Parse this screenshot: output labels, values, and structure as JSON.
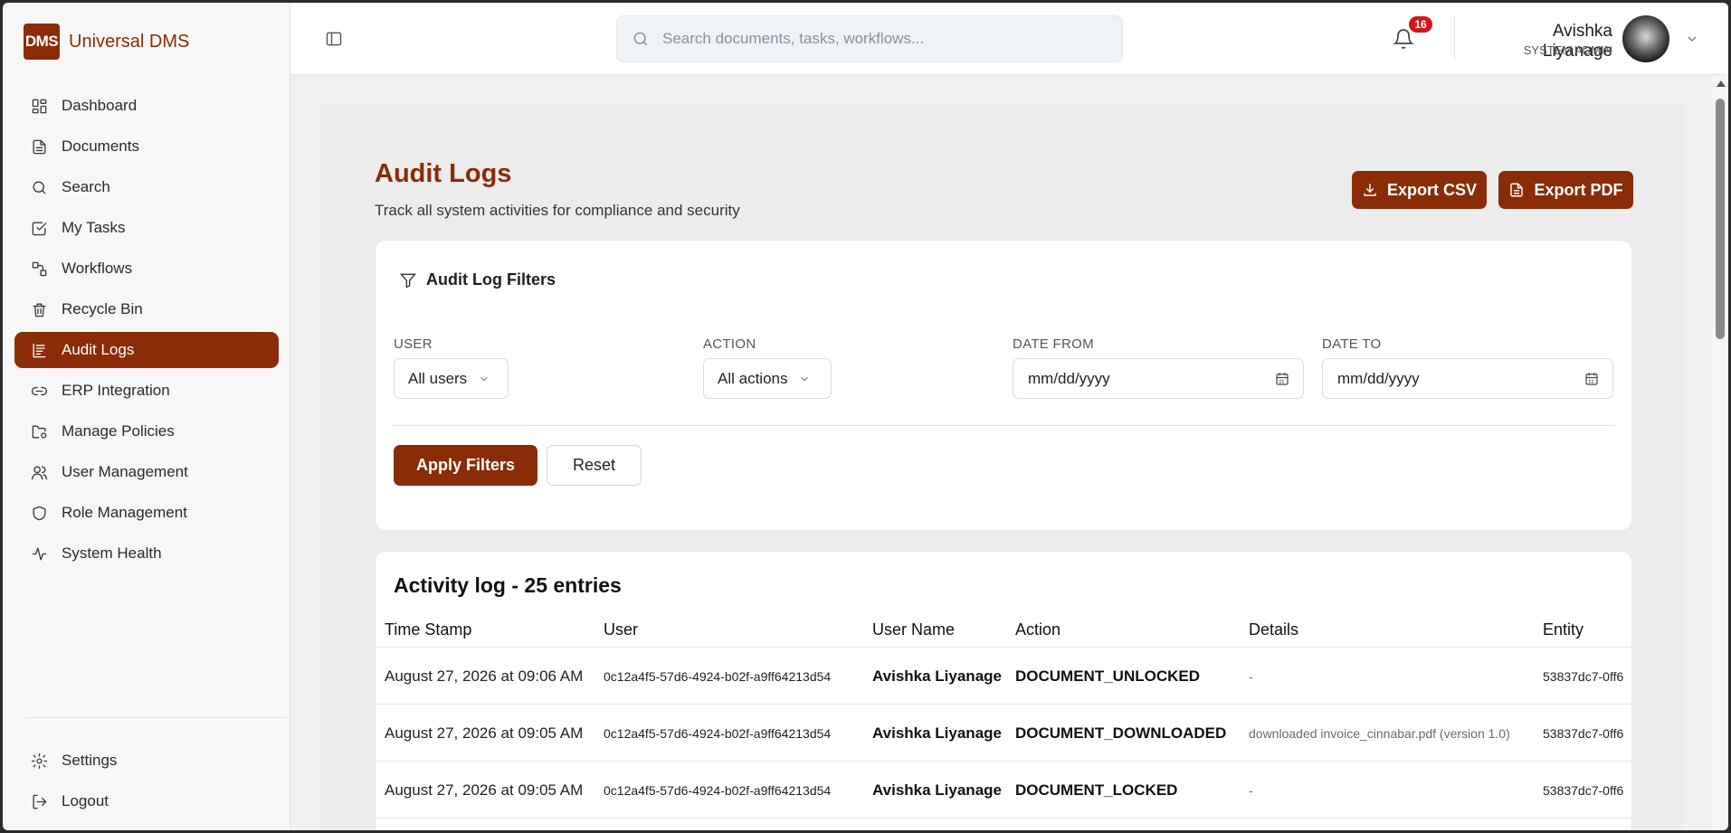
{
  "brand": {
    "logo_text": "DMS",
    "name": "Universal DMS"
  },
  "sidebar": {
    "items": [
      {
        "label": "Dashboard",
        "icon": "dashboard-icon"
      },
      {
        "label": "Documents",
        "icon": "document-icon"
      },
      {
        "label": "Search",
        "icon": "search-icon"
      },
      {
        "label": "My Tasks",
        "icon": "checkbox-icon"
      },
      {
        "label": "Workflows",
        "icon": "workflow-icon"
      },
      {
        "label": "Recycle Bin",
        "icon": "trash-icon"
      },
      {
        "label": "Audit Logs",
        "icon": "audit-icon",
        "active": true
      },
      {
        "label": "ERP Integration",
        "icon": "link-icon"
      },
      {
        "label": "Manage Policies",
        "icon": "folder-settings-icon"
      },
      {
        "label": "User Management",
        "icon": "users-icon"
      },
      {
        "label": "Role Management",
        "icon": "shield-icon"
      },
      {
        "label": "System Health",
        "icon": "activity-icon"
      }
    ],
    "bottom_items": [
      {
        "label": "Settings",
        "icon": "gear-icon"
      },
      {
        "label": "Logout",
        "icon": "logout-icon"
      }
    ]
  },
  "header": {
    "search_placeholder": "Search documents, tasks, workflows...",
    "notification_count": "16",
    "user_name": "Avishka Liyanage",
    "user_role": "SYSTEM ADMIN"
  },
  "page": {
    "title": "Audit Logs",
    "subtitle": "Track all system activities for compliance and security",
    "export_csv": "Export CSV",
    "export_pdf": "Export PDF"
  },
  "filters": {
    "title": "Audit Log Filters",
    "user_label": "USER",
    "user_value": "All users",
    "action_label": "ACTION",
    "action_value": "All actions",
    "date_from_label": "DATE FROM",
    "date_from_value": "mm/dd/yyyy",
    "date_to_label": "DATE TO",
    "date_to_value": "mm/dd/yyyy",
    "apply_label": "Apply Filters",
    "reset_label": "Reset"
  },
  "log": {
    "title": "Activity log - 25 entries",
    "columns": [
      "Time Stamp",
      "User",
      "User Name",
      "Action",
      "Details",
      "Entity"
    ],
    "rows": [
      {
        "timestamp": "August 27, 2026 at 09:06 AM",
        "user": "0c12a4f5-57d6-4924-b02f-a9ff64213d54",
        "user_name": "Avishka Liyanage",
        "action": "DOCUMENT_UNLOCKED",
        "details": "-",
        "entity": "53837dc7-0ff6"
      },
      {
        "timestamp": "August 27, 2026 at 09:05 AM",
        "user": "0c12a4f5-57d6-4924-b02f-a9ff64213d54",
        "user_name": "Avishka Liyanage",
        "action": "DOCUMENT_DOWNLOADED",
        "details": "downloaded invoice_cinnabar.pdf (version 1.0)",
        "entity": "53837dc7-0ff6"
      },
      {
        "timestamp": "August 27, 2026 at 09:05 AM",
        "user": "0c12a4f5-57d6-4924-b02f-a9ff64213d54",
        "user_name": "Avishka Liyanage",
        "action": "DOCUMENT_LOCKED",
        "details": "-",
        "entity": "53837dc7-0ff6"
      }
    ]
  }
}
